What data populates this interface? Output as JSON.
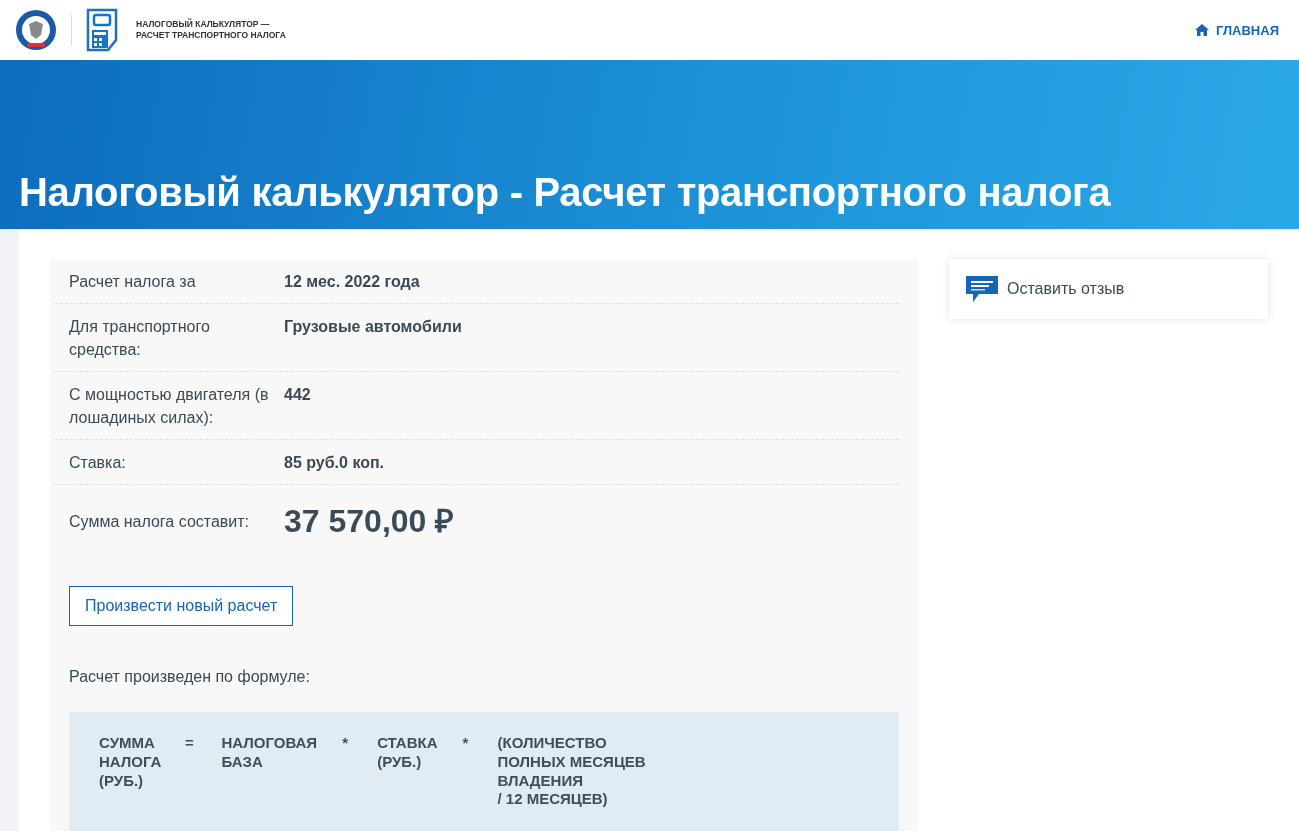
{
  "header": {
    "logo_text": "НАЛОГОВЫЙ КАЛЬКУЛЯТОР —\nРАСЧЕТ ТРАНСПОРТНОГО НАЛОГА",
    "nav_link": "ГЛАВНАЯ"
  },
  "hero": {
    "title": "Налоговый калькулятор - Расчет транспортного налога"
  },
  "result": {
    "rows": [
      {
        "kind": "plain",
        "label": "Расчет налога за",
        "value": "12 мес. 2022 года"
      },
      {
        "kind": "plain",
        "label": "Для транспортного средства:",
        "value": "Грузовые автомобили"
      },
      {
        "kind": "plain",
        "label": "С мощностью двигателя (в лошадиных силах):",
        "value": "442"
      },
      {
        "kind": "plain",
        "label": "Ставка:",
        "value": "85 руб.0 коп."
      },
      {
        "kind": "total",
        "label": "Сумма налога составит:",
        "value": "37 570,00 ₽"
      }
    ],
    "button": "Произвести новый расчет",
    "formula_caption": "Расчет произведен по формуле:",
    "formula": [
      {
        "kind": "term",
        "text": "СУММА\nНАЛОГА\n(РУБ.)"
      },
      {
        "kind": "operator",
        "text": "="
      },
      {
        "kind": "term",
        "text": "НАЛОГОВАЯ\nБАЗА"
      },
      {
        "kind": "operator",
        "text": "*"
      },
      {
        "kind": "term",
        "text": "СТАВКА\n(РУБ.)"
      },
      {
        "kind": "operator",
        "text": "*"
      },
      {
        "kind": "term",
        "text": "(КОЛИЧЕСТВО\nПОЛНЫХ МЕСЯЦЕВ\nВЛАДЕНИЯ\n/ 12 МЕСЯЦЕВ)"
      }
    ]
  },
  "feedback": {
    "label": "Оставить отзыв"
  }
}
